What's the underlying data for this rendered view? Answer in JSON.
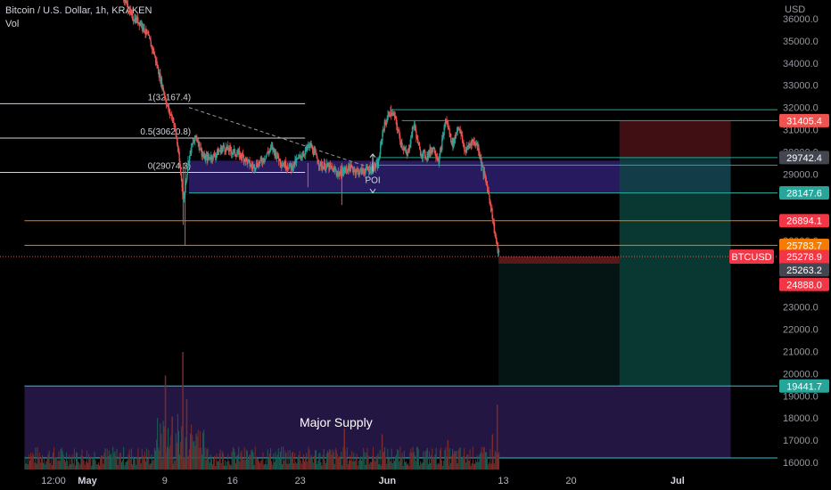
{
  "header": {
    "symbol_line": "Bitcoin / U.S. Dollar, 1h, KRAKEN",
    "sub_line": "Vol"
  },
  "chart_data": {
    "type": "candlestick",
    "currency_label": "USD",
    "y_axis": {
      "ticks": [
        36000,
        35000,
        34000,
        33000,
        32000,
        31000,
        30000,
        29000,
        28000,
        27000,
        26000,
        25000,
        24000,
        23000,
        22000,
        21000,
        20000,
        19000,
        18000,
        17000,
        16000
      ],
      "tick_labels": [
        "36000.0",
        "35000.0",
        "34000.0",
        "33000.0",
        "32000.0",
        "31000.0",
        "30000.0",
        "29000.0",
        "28000.0",
        "27000.0",
        "26000.0",
        "25000.0",
        "24000.0",
        "23000.0",
        "22000.0",
        "21000.0",
        "20000.0",
        "19000.0",
        "18000.0",
        "17000.0",
        "16000.0"
      ],
      "ylim": [
        15800,
        36300
      ]
    },
    "x_axis": {
      "labels": [
        {
          "text": "12:00",
          "day": -3.5,
          "bold": false
        },
        {
          "text": "May",
          "day": 0,
          "bold": true
        },
        {
          "text": "9",
          "day": 8,
          "bold": false
        },
        {
          "text": "16",
          "day": 15,
          "bold": false
        },
        {
          "text": "23",
          "day": 22,
          "bold": false
        },
        {
          "text": "Jun",
          "day": 31,
          "bold": true
        },
        {
          "text": "13",
          "day": 43,
          "bold": false
        },
        {
          "text": "20",
          "day": 50,
          "bold": false
        },
        {
          "text": "Jul",
          "day": 61,
          "bold": true
        }
      ],
      "xlim": [
        -6.5,
        66.5
      ]
    },
    "price_path": [
      {
        "day": 4.5,
        "price": 36100
      },
      {
        "day": 5.5,
        "price": 35800
      },
      {
        "day": 6.2,
        "price": 35200
      },
      {
        "day": 6.8,
        "price": 34500
      },
      {
        "day": 7.3,
        "price": 33600
      },
      {
        "day": 7.8,
        "price": 32800
      },
      {
        "day": 8.3,
        "price": 31900
      },
      {
        "day": 8.8,
        "price": 31500
      },
      {
        "day": 9.2,
        "price": 30500
      },
      {
        "day": 9.6,
        "price": 29000
      },
      {
        "day": 9.9,
        "price": 27800
      },
      {
        "day": 10.3,
        "price": 29400
      },
      {
        "day": 10.7,
        "price": 30200
      },
      {
        "day": 11.2,
        "price": 30700
      },
      {
        "day": 12,
        "price": 29700
      },
      {
        "day": 13,
        "price": 29800
      },
      {
        "day": 14,
        "price": 30200
      },
      {
        "day": 15,
        "price": 30000
      },
      {
        "day": 16,
        "price": 29800
      },
      {
        "day": 17,
        "price": 29300
      },
      {
        "day": 18,
        "price": 29600
      },
      {
        "day": 19,
        "price": 30200
      },
      {
        "day": 20,
        "price": 29500
      },
      {
        "day": 21,
        "price": 29300
      },
      {
        "day": 22,
        "price": 29800
      },
      {
        "day": 23,
        "price": 30300
      },
      {
        "day": 24,
        "price": 29400
      },
      {
        "day": 25,
        "price": 29300
      },
      {
        "day": 26,
        "price": 29000
      },
      {
        "day": 27,
        "price": 29300
      },
      {
        "day": 28,
        "price": 29100
      },
      {
        "day": 29,
        "price": 29200
      },
      {
        "day": 30,
        "price": 29400
      },
      {
        "day": 30.5,
        "price": 31000
      },
      {
        "day": 31.2,
        "price": 31800
      },
      {
        "day": 31.7,
        "price": 31600
      },
      {
        "day": 32.3,
        "price": 30500
      },
      {
        "day": 33,
        "price": 29800
      },
      {
        "day": 33.7,
        "price": 31300
      },
      {
        "day": 34.3,
        "price": 30000
      },
      {
        "day": 35,
        "price": 29800
      },
      {
        "day": 35.7,
        "price": 30200
      },
      {
        "day": 36.3,
        "price": 29600
      },
      {
        "day": 37,
        "price": 31500
      },
      {
        "day": 37.7,
        "price": 30300
      },
      {
        "day": 38.3,
        "price": 31200
      },
      {
        "day": 39,
        "price": 30000
      },
      {
        "day": 39.7,
        "price": 30500
      },
      {
        "day": 40.3,
        "price": 30300
      },
      {
        "day": 40.8,
        "price": 29200
      },
      {
        "day": 41.2,
        "price": 28600
      },
      {
        "day": 41.6,
        "price": 27700
      },
      {
        "day": 41.9,
        "price": 26800
      },
      {
        "day": 42.3,
        "price": 25700
      },
      {
        "day": 42.5,
        "price": 25300
      }
    ],
    "volume_spikes": [
      {
        "day": 8,
        "value": 0.8
      },
      {
        "day": 9.8,
        "value": 1.0
      },
      {
        "day": 10.2,
        "value": 0.6
      },
      {
        "day": 8.7,
        "value": 0.45
      },
      {
        "day": 26.5,
        "value": 0.35
      },
      {
        "day": 30.4,
        "value": 0.3
      },
      {
        "day": 37.2,
        "value": 0.25
      },
      {
        "day": 42.3,
        "value": 0.55
      },
      {
        "day": 41.8,
        "value": 0.3
      }
    ],
    "fibonacci": [
      {
        "label": "1(32167.4)",
        "price": 32167.4
      },
      {
        "label": "0.5(30620.8)",
        "price": 30620.8
      },
      {
        "label": "0(29074.3)",
        "price": 29074.3
      }
    ],
    "trendline": {
      "from": {
        "day": 10.5,
        "price": 32000
      },
      "to": {
        "day": 29.5,
        "price": 29250
      }
    },
    "zones": [
      {
        "name": "POI",
        "label": "POI",
        "from_day": 10.5,
        "to_day": 66.5,
        "top": 29600,
        "bottom": 28147.6,
        "color": "#2e1f6e"
      },
      {
        "name": "Major Supply",
        "label": "Major Supply",
        "from_day": -6.5,
        "to_day": 66.5,
        "top": 19441.7,
        "bottom": 16200,
        "color": "#2a1a4e"
      }
    ],
    "levels": [
      {
        "price": 31900,
        "color": "#26a69a",
        "from_day": 31.5
      },
      {
        "price": 31405.4,
        "color": "#26a69a",
        "from_day": 32.5
      },
      {
        "price": 29742.4,
        "color": "#26a69a",
        "from_day": 30
      },
      {
        "price": 29400,
        "color": "#26a69a",
        "from_day": 30
      },
      {
        "price": 28147.6,
        "color": "#26a69a",
        "from_day": 10.5
      },
      {
        "price": 26894.1,
        "color": "#f57c00",
        "from_day": -6.5
      },
      {
        "price": 25783.7,
        "color": "#f57c00",
        "from_day": -6.5
      },
      {
        "price": 19441.7,
        "color": "#26c6da",
        "from_day": -6.5
      },
      {
        "price": 16200,
        "color": "#26c6da",
        "from_day": -6.5
      }
    ],
    "position": {
      "start_day": 42.5,
      "end_day": 66.5,
      "entry": 25278.9,
      "stop": 31405.4,
      "target": 19441.7,
      "mid": 29742.4,
      "split_day": 55
    },
    "price_labels": [
      {
        "text": "31405.4",
        "price": 31405.4,
        "bg": "#ef5350",
        "fg": "#ffffff"
      },
      {
        "text": "29742.4",
        "price": 29742.4,
        "bg": "#434651",
        "fg": "#ffffff"
      },
      {
        "text": "28147.6",
        "price": 28147.6,
        "bg": "#26a69a",
        "fg": "#ffffff"
      },
      {
        "text": "26894.1",
        "price": 26894.1,
        "bg": "#f23645",
        "fg": "#ffffff"
      },
      {
        "text": "25783.7",
        "price": 25783.7,
        "bg": "#f57c00",
        "fg": "#ffffff"
      },
      {
        "text": "25278.9",
        "price": 25278.9,
        "bg": "#f23645",
        "fg": "#ffffff",
        "sub": "35:22"
      },
      {
        "text": "25263.2",
        "price": 24680,
        "bg": "#434651",
        "fg": "#ffffff"
      },
      {
        "text": "24888.0",
        "price": 24020,
        "bg": "#f23645",
        "fg": "#ffffff"
      },
      {
        "text": "19441.7",
        "price": 19441.7,
        "bg": "#26a69a",
        "fg": "#ffffff"
      }
    ],
    "last_price_tag": "BTCUSD",
    "last_price": 25278.9
  },
  "colors": {
    "up": "#26a69a",
    "down": "#ef5350",
    "fib": "#d1d4dc",
    "vol_up": "#1b5e52",
    "vol_down": "#7a2a2a"
  }
}
